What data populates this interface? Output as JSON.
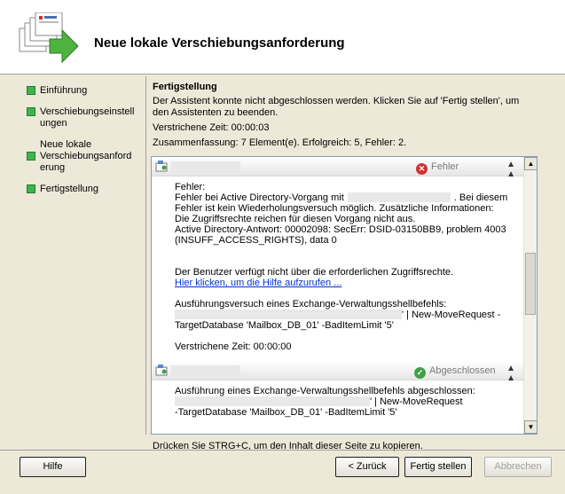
{
  "header": {
    "title": "Neue lokale Verschiebungsanforderung"
  },
  "nav": {
    "items": [
      {
        "label": "Einführung"
      },
      {
        "label": "Verschiebungseinstell ungen"
      },
      {
        "label": "Neue lokale Verschiebungsanford erung"
      },
      {
        "label": "Fertigstellung"
      }
    ]
  },
  "content": {
    "title": "Fertigstellung",
    "message": "Der Assistent konnte nicht abgeschlossen werden. Klicken Sie auf 'Fertig stellen', um den Assistenten zu beenden.",
    "elapsed": "Verstrichene Zeit: 00:00:03",
    "summary": "Zusammenfassung: 7 Element(e). Erfolgreich: 5, Fehler: 2."
  },
  "items": [
    {
      "status": "Fehler",
      "lines": {
        "l1": "Fehler:",
        "l2a": "Fehler bei Active Directory-Vorgang mit",
        "l2b": ". Bei diesem",
        "l3": "Fehler ist kein Wiederholungsversuch möglich. Zusätzliche Informationen:",
        "l4": "Die Zugriffsrechte reichen für diesen Vorgang nicht aus.",
        "l5": "Active Directory-Antwort: 00002098: SecErr: DSID-03150BB9, problem 4003",
        "l6": "(INSUFF_ACCESS_RIGHTS), data 0",
        "l7": "Der Benutzer verfügt nicht über die erforderlichen Zugriffsrechte.",
        "help_link": "Hier klicken, um die Hilfe aufzurufen ...",
        "l8": "Ausführungsversuch eines Exchange-Verwaltungsshellbefehls:",
        "l9": "' | New-MoveRequest -",
        "l10": "TargetDatabase 'Mailbox_DB_01' -BadItemLimit '5'",
        "l11": "Verstrichene Zeit: 00:00:00"
      }
    },
    {
      "status": "Abgeschlossen",
      "lines": {
        "l1": "Ausführung eines Exchange-Verwaltungsshellbefehls abgeschlossen:",
        "l2": "' | New-MoveRequest",
        "l3": "-TargetDatabase 'Mailbox_DB_01' -BadItemLimit '5'"
      }
    }
  ],
  "copy_hint": "Drücken Sie STRG+C, um den Inhalt dieser Seite zu kopieren.",
  "buttons": {
    "help": "Hilfe",
    "back": "< Zurück",
    "finish": "Fertig stellen",
    "cancel": "Abbrechen"
  }
}
